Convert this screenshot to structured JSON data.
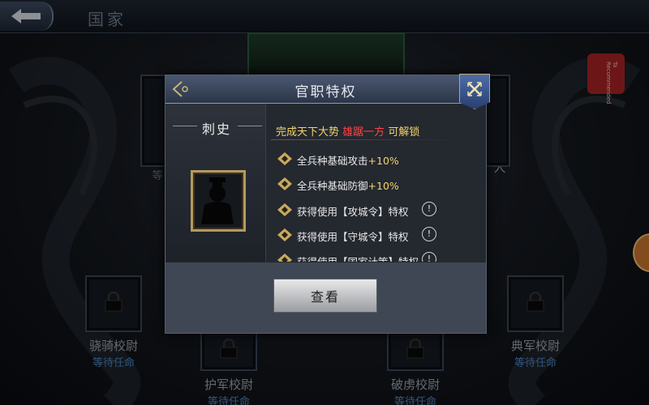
{
  "header": {
    "page_title": "国家",
    "back_icon": "back-arrow-icon"
  },
  "seal": {
    "text": "Ta Recommended"
  },
  "slots": [
    {
      "name": "骁骑校尉",
      "status": "等待任命"
    },
    {
      "name": "护军校尉",
      "status": "等待任命"
    },
    {
      "name": "破虏校尉",
      "status": "等待任命"
    },
    {
      "name": "典军校尉",
      "status": "等待任命"
    },
    {
      "name": "",
      "status": "等"
    },
    {
      "name": "人",
      "status": ""
    }
  ],
  "modal": {
    "title": "官职特权",
    "rank": "刺史",
    "condition": {
      "white_1": "完成天下大势",
      "red": "雄踞一方",
      "white_2": "可解锁"
    },
    "perks": [
      {
        "text": "全兵种基础攻击",
        "bonus": "+10%",
        "info": ""
      },
      {
        "text": "全兵种基础防御",
        "bonus": "+10%",
        "info": ""
      },
      {
        "text": "获得使用【攻城令】特权",
        "bonus": "",
        "info": "!"
      },
      {
        "text": "获得使用【守城令】特权",
        "bonus": "",
        "info": "!"
      },
      {
        "text": "获得使用【国家计策】特权",
        "bonus": "",
        "info": "!"
      }
    ],
    "view_button": "查看"
  },
  "colors": {
    "gold": "#f2d46a",
    "red": "#ff4444",
    "status_blue": "#4e86c4",
    "frame_gold": "#b59a5e"
  }
}
